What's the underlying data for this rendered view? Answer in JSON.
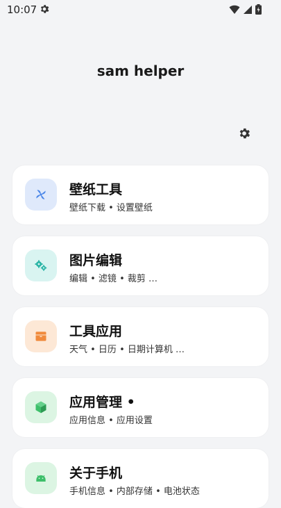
{
  "status_bar": {
    "time": "10:07",
    "icons": [
      "settings-icon",
      "wifi-icon",
      "signal-icon",
      "battery-icon"
    ]
  },
  "app": {
    "title": "sam helper"
  },
  "cards": [
    {
      "title": "壁纸工具",
      "subtitle": "壁纸下载 • 设置壁纸",
      "icon": "pinwheel-icon",
      "icon_bg": "#dfe9fb",
      "icon_color": "#4a86e8"
    },
    {
      "title": "图片编辑",
      "subtitle": "编辑 • 滤镜 • 裁剪 …",
      "icon": "gears-icon",
      "icon_bg": "#d9f4f1",
      "icon_color": "#2bb5a6"
    },
    {
      "title": "工具应用",
      "subtitle": "天气 • 日历 • 日期计算机 …",
      "icon": "box-icon",
      "icon_bg": "#fde8d6",
      "icon_color": "#f08a3c"
    },
    {
      "title": "应用管理 •",
      "subtitle": "应用信息 • 应用设置",
      "icon": "cube-icon",
      "icon_bg": "#dcf5e3",
      "icon_color": "#3dbf6a"
    },
    {
      "title": "关于手机",
      "subtitle": "手机信息 • 内部存储 • 电池状态",
      "icon": "android-icon",
      "icon_bg": "#dcf5e3",
      "icon_color": "#3dbf6a"
    }
  ]
}
